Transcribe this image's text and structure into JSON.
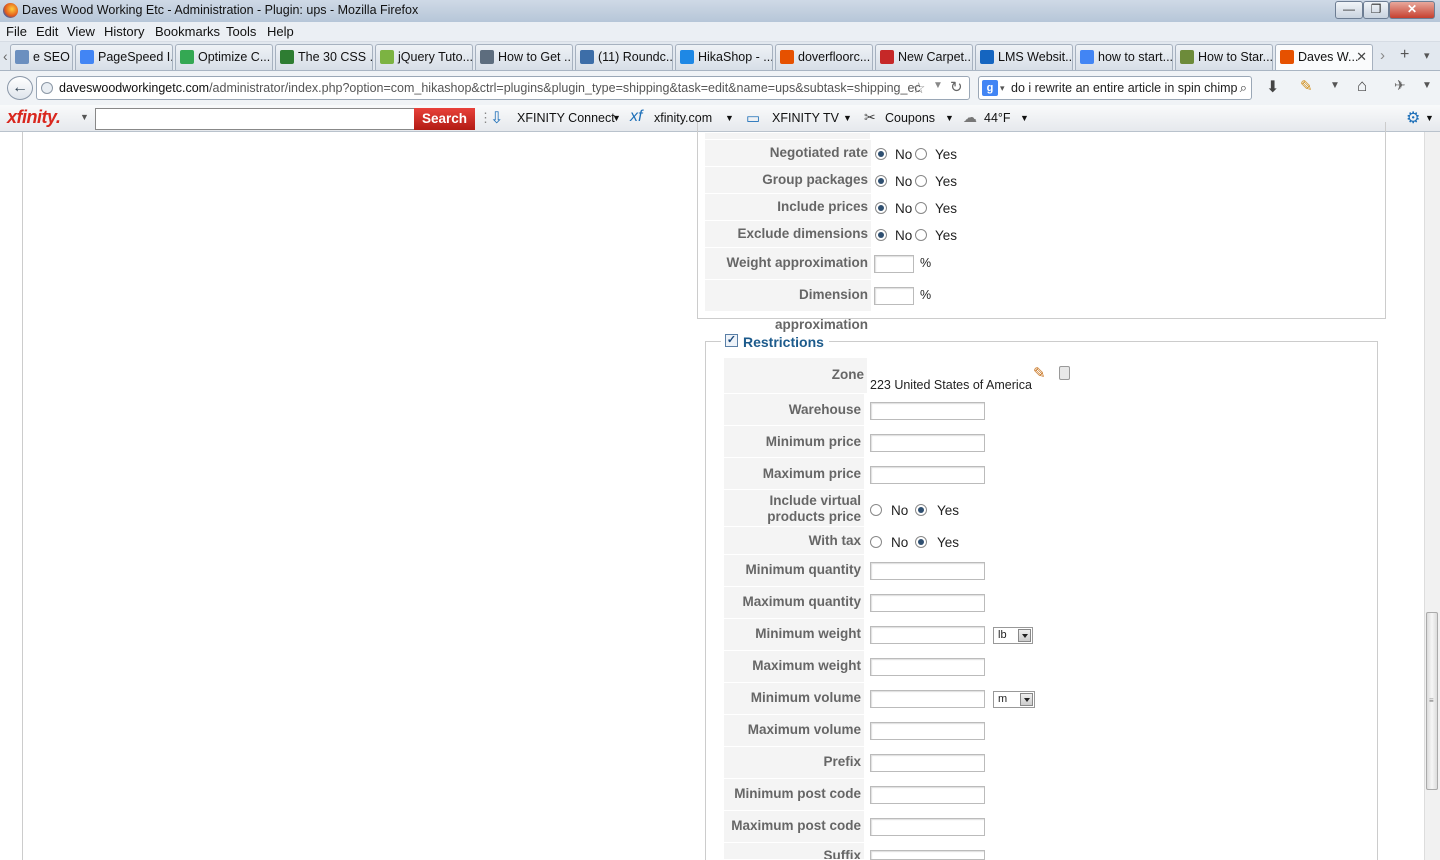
{
  "window": {
    "title": "Daves Wood Working Etc - Administration - Plugin: ups - Mozilla Firefox",
    "minimize": "—",
    "restore": "❐",
    "close": "✕"
  },
  "menu": [
    "File",
    "Edit",
    "View",
    "History",
    "Bookmarks",
    "Tools",
    "Help"
  ],
  "tabs": [
    {
      "label": "e SEO T...",
      "icon_color": "#6b8fbf"
    },
    {
      "label": "PageSpeed I...",
      "icon_color": "#4285f4"
    },
    {
      "label": "Optimize C...",
      "icon_color": "#34a853"
    },
    {
      "label": "The 30 CSS ...",
      "icon_color": "#2e7d32"
    },
    {
      "label": "jQuery Tuto...",
      "icon_color": "#7cb342"
    },
    {
      "label": "How to Get ...",
      "icon_color": "#5d6d7e"
    },
    {
      "label": "(11) Roundc...",
      "icon_color": "#3d6ea8"
    },
    {
      "label": "HikaShop - ...",
      "icon_color": "#1e88e5"
    },
    {
      "label": "doverfloorc...",
      "icon_color": "#e65100"
    },
    {
      "label": "New Carpet...",
      "icon_color": "#c62828"
    },
    {
      "label": "LMS Websit...",
      "icon_color": "#1565c0"
    },
    {
      "label": "how to start...",
      "icon_color": "#4285f4"
    },
    {
      "label": "How to Star...",
      "icon_color": "#6d8b3a"
    },
    {
      "label": "Daves W...",
      "icon_color": "#e65100"
    }
  ],
  "nav": {
    "url_domain": "daveswoodworkingetc.com",
    "url_path": "/administrator/index.php?option=com_hikashop&ctrl=plugins&plugin_type=shipping&task=edit&name=ups&subtask=shipping_ec",
    "search_query": "do i rewrite an entire article in spin chimp"
  },
  "xfinity": {
    "logo": "xfinity.",
    "search_button": "Search",
    "connect": "XFINITY Connect",
    "site": "xfinity.com",
    "tv": "XFINITY TV",
    "coupons": "Coupons",
    "weather": "44°F"
  },
  "options": {
    "no_label": "No",
    "yes_label": "Yes",
    "percent": "%",
    "radio_rows": [
      {
        "label": "Negotiated rate",
        "value": "No"
      },
      {
        "label": "Group packages",
        "value": "No"
      },
      {
        "label": "Include prices",
        "value": "No"
      },
      {
        "label": "Exclude dimensions",
        "value": "No"
      }
    ],
    "weight_approx_label": "Weight approximation",
    "dimension_approx_label": "Dimension approximation"
  },
  "restrictions": {
    "legend": "Restrictions",
    "enabled": true,
    "zone_label": "Zone",
    "zone_value": "223 United States of America",
    "warehouse": "Warehouse",
    "min_price": "Minimum price",
    "max_price": "Maximum price",
    "virtual_label_1": "Include virtual",
    "virtual_label_2": "products price",
    "virtual_value": "Yes",
    "with_tax": "With tax",
    "with_tax_value": "Yes",
    "min_qty": "Minimum quantity",
    "max_qty": "Maximum quantity",
    "min_weight": "Minimum weight",
    "weight_unit": "lb",
    "max_weight": "Maximum weight",
    "min_volume": "Minimum volume",
    "volume_unit": "m",
    "max_volume": "Maximum volume",
    "prefix": "Prefix",
    "min_post": "Minimum post code",
    "max_post": "Maximum post code",
    "suffix": "Suffix"
  }
}
